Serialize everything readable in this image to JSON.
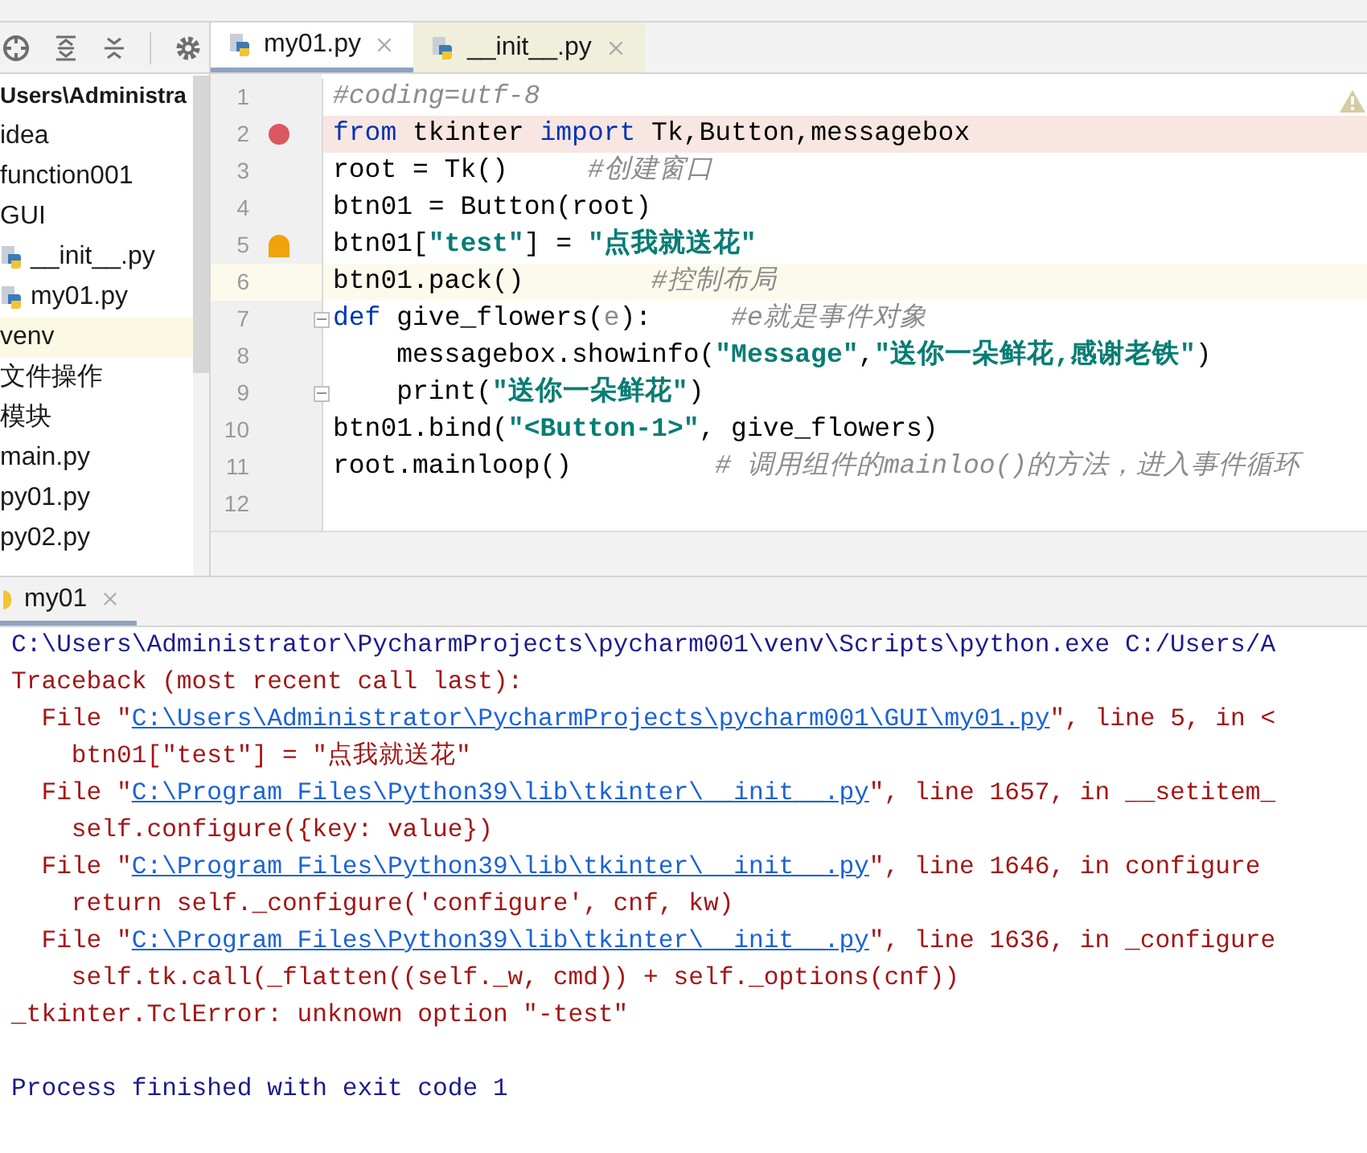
{
  "project_tree": [
    {
      "name": "Users\\Administra",
      "selected": false,
      "children": [
        {
          "name": "idea",
          "selected": false
        },
        {
          "name": "function001",
          "selected": false
        },
        {
          "name": "GUI",
          "selected": false,
          "children": [
            {
              "name": "__init__.py",
              "kind": "python",
              "selected": false
            },
            {
              "name": "my01.py",
              "kind": "python",
              "selected": false
            }
          ]
        },
        {
          "name": "venv",
          "selected": true
        },
        {
          "name": "文件操作",
          "selected": false
        },
        {
          "name": "模块",
          "selected": false
        },
        {
          "name": "main.py",
          "selected": false
        },
        {
          "name": "py01.py",
          "selected": false
        },
        {
          "name": "py02.py",
          "selected": false
        }
      ]
    }
  ],
  "editor_tabs": [
    {
      "label": "my01.py",
      "selected": true
    },
    {
      "label": "__init__.py",
      "selected": false
    }
  ],
  "code_lines": [
    {
      "number": "1",
      "breakpoint": false,
      "current": false,
      "fold": false,
      "bulb": false,
      "segments": [
        {
          "kind": "comment",
          "text": "#coding=utf-8"
        }
      ]
    },
    {
      "number": "2",
      "breakpoint": true,
      "current": false,
      "fold": false,
      "bulb": false,
      "segments": [
        {
          "kind": "keyword",
          "text": "from"
        },
        {
          "kind": "plain",
          "text": " tkinter "
        },
        {
          "kind": "keyword",
          "text": "import"
        },
        {
          "kind": "plain",
          "text": " Tk,Button,messagebox"
        }
      ]
    },
    {
      "number": "3",
      "breakpoint": false,
      "current": false,
      "fold": false,
      "bulb": false,
      "segments": [
        {
          "kind": "plain",
          "text": "root = Tk()     "
        },
        {
          "kind": "comment",
          "text": "#创建窗口"
        }
      ]
    },
    {
      "number": "4",
      "breakpoint": false,
      "current": false,
      "fold": false,
      "bulb": false,
      "segments": [
        {
          "kind": "plain",
          "text": "btn01 = Button(root)"
        }
      ]
    },
    {
      "number": "5",
      "breakpoint": false,
      "current": false,
      "fold": false,
      "bulb": true,
      "segments": [
        {
          "kind": "plain",
          "text": "btn01["
        },
        {
          "kind": "string",
          "text": "\"test\""
        },
        {
          "kind": "plain",
          "text": "] = "
        },
        {
          "kind": "string",
          "text": "\"点我就送花\""
        }
      ]
    },
    {
      "number": "6",
      "breakpoint": false,
      "current": true,
      "fold": false,
      "bulb": false,
      "segments": [
        {
          "kind": "plain",
          "text": "btn01.pack()        "
        },
        {
          "kind": "comment",
          "text": "#控制布局"
        }
      ]
    },
    {
      "number": "7",
      "breakpoint": false,
      "current": false,
      "fold": true,
      "bulb": false,
      "segments": [
        {
          "kind": "keyword",
          "text": "def"
        },
        {
          "kind": "plain",
          "text": " give_flowers("
        },
        {
          "kind": "param",
          "text": "e"
        },
        {
          "kind": "plain",
          "text": "):     "
        },
        {
          "kind": "comment",
          "text": "#e就是事件对象"
        }
      ]
    },
    {
      "number": "8",
      "breakpoint": false,
      "current": false,
      "fold": false,
      "bulb": false,
      "segments": [
        {
          "kind": "plain",
          "text": "    messagebox.showinfo("
        },
        {
          "kind": "string",
          "text": "\"Message\""
        },
        {
          "kind": "plain",
          "text": ","
        },
        {
          "kind": "string",
          "text": "\"送你一朵鲜花,感谢老铁\""
        },
        {
          "kind": "plain",
          "text": ")"
        }
      ]
    },
    {
      "number": "9",
      "breakpoint": false,
      "current": false,
      "fold": true,
      "bulb": false,
      "segments": [
        {
          "kind": "plain",
          "text": "    print("
        },
        {
          "kind": "string",
          "text": "\"送你一朵鲜花\""
        },
        {
          "kind": "plain",
          "text": ")"
        }
      ]
    },
    {
      "number": "10",
      "breakpoint": false,
      "current": false,
      "fold": false,
      "bulb": false,
      "segments": [
        {
          "kind": "plain",
          "text": "btn01.bind("
        },
        {
          "kind": "string",
          "text": "\"<Button-1>\""
        },
        {
          "kind": "plain",
          "text": ", give_flowers)"
        }
      ]
    },
    {
      "number": "11",
      "breakpoint": false,
      "current": false,
      "fold": false,
      "bulb": false,
      "segments": [
        {
          "kind": "plain",
          "text": "root.mainloop()         "
        },
        {
          "kind": "comment",
          "text": "# 调用组件的mainloo()的方法，进入事件循环"
        }
      ]
    },
    {
      "number": "12",
      "breakpoint": false,
      "current": false,
      "fold": false,
      "bulb": false
    }
  ],
  "run_panel": {
    "tab": "my01"
  },
  "console_lines": [
    {
      "kind": "command",
      "segments": [
        {
          "kind": "text",
          "text": "C:\\Users\\Administrator\\PycharmProjects\\pycharm001\\venv\\Scripts\\python.exe C:/Users/A"
        }
      ]
    },
    {
      "kind": "error",
      "segments": [
        {
          "kind": "text",
          "text": "Traceback (most recent call last):"
        }
      ]
    },
    {
      "kind": "error",
      "segments": [
        {
          "kind": "text",
          "text": "  File \""
        },
        {
          "kind": "link",
          "text": "C:\\Users\\Administrator\\PycharmProjects\\pycharm001\\GUI\\my01.py"
        },
        {
          "kind": "text",
          "text": "\", line 5, in <"
        }
      ]
    },
    {
      "kind": "error",
      "segments": [
        {
          "kind": "text",
          "text": "    btn01[\"test\"] = \"点我就送花\""
        }
      ]
    },
    {
      "kind": "error",
      "segments": [
        {
          "kind": "text",
          "text": "  File \""
        },
        {
          "kind": "link",
          "text": "C:\\Program Files\\Python39\\lib\\tkinter\\__init__.py"
        },
        {
          "kind": "text",
          "text": "\", line 1657, in __setitem_"
        }
      ]
    },
    {
      "kind": "error",
      "segments": [
        {
          "kind": "text",
          "text": "    self.configure({key: value})"
        }
      ]
    },
    {
      "kind": "error",
      "segments": [
        {
          "kind": "text",
          "text": "  File \""
        },
        {
          "kind": "link",
          "text": "C:\\Program Files\\Python39\\lib\\tkinter\\__init__.py"
        },
        {
          "kind": "text",
          "text": "\", line 1646, in configure"
        }
      ]
    },
    {
      "kind": "error",
      "segments": [
        {
          "kind": "text",
          "text": "    return self._configure('configure', cnf, kw)"
        }
      ]
    },
    {
      "kind": "error",
      "segments": [
        {
          "kind": "text",
          "text": "  File \""
        },
        {
          "kind": "link",
          "text": "C:\\Program Files\\Python39\\lib\\tkinter\\__init__.py"
        },
        {
          "kind": "text",
          "text": "\", line 1636, in _configure"
        }
      ]
    },
    {
      "kind": "error",
      "segments": [
        {
          "kind": "text",
          "text": "    self.tk.call(_flatten((self._w, cmd)) + self._options(cnf))"
        }
      ]
    },
    {
      "kind": "error",
      "segments": [
        {
          "kind": "text",
          "text": "_tkinter.TclError: unknown option \"-test\""
        }
      ]
    },
    {
      "kind": "blank"
    },
    {
      "kind": "command",
      "segments": [
        {
          "kind": "text",
          "text": "Process finished with exit code 1"
        }
      ]
    }
  ]
}
